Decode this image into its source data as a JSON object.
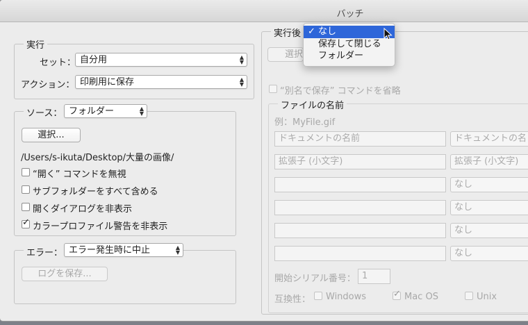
{
  "window": {
    "title": "バッチ"
  },
  "run": {
    "legend": "実行",
    "set_label": "セット：",
    "set_value": "自分用",
    "action_label": "アクション：",
    "action_value": "印刷用に保存"
  },
  "source": {
    "label": "ソース：",
    "value": "フォルダー",
    "choose_button": "選択...",
    "path": "/Users/s-ikuta/Desktop/大量の画像/",
    "checkboxes": [
      {
        "label": "“開く” コマンドを無視",
        "checked": false
      },
      {
        "label": "サブフォルダーをすべて含める",
        "checked": false
      },
      {
        "label": "開くダイアログを非表示",
        "checked": false
      },
      {
        "label": "カラープロファイル警告を非表示",
        "checked": true
      }
    ]
  },
  "error": {
    "label": "エラー：",
    "value": "エラー発生時に中止",
    "save_log_button": "ログを保存..."
  },
  "after": {
    "legend": "実行後",
    "choose_button": "選択",
    "override_save_label": "“別名で保存” コマンドを省略",
    "dropdown": {
      "items": [
        {
          "label": "なし",
          "selected": true,
          "check": "✓"
        },
        {
          "label": "保存して閉じる",
          "selected": false
        },
        {
          "label": "フォルダー",
          "selected": false
        }
      ]
    }
  },
  "file_naming": {
    "legend": "ファイルの名前",
    "example": "例：MyFile.gif",
    "rows": [
      {
        "text_placeholder": "ドキュメントの名前",
        "select": "ドキュメントの名"
      },
      {
        "text_placeholder": "拡張子 (小文字)",
        "select": "拡張子 (小文字)"
      },
      {
        "text_placeholder": "",
        "select": "なし"
      },
      {
        "text_placeholder": "",
        "select": "なし"
      },
      {
        "text_placeholder": "",
        "select": "なし"
      },
      {
        "text_placeholder": "",
        "select": "なし"
      }
    ],
    "serial_label": "開始シリアル番号：",
    "serial_value": "1",
    "compat_label": "互換性：",
    "compat": [
      {
        "label": "Windows",
        "checked": false
      },
      {
        "label": "Mac OS",
        "checked": true
      },
      {
        "label": "Unix",
        "checked": false
      }
    ]
  }
}
